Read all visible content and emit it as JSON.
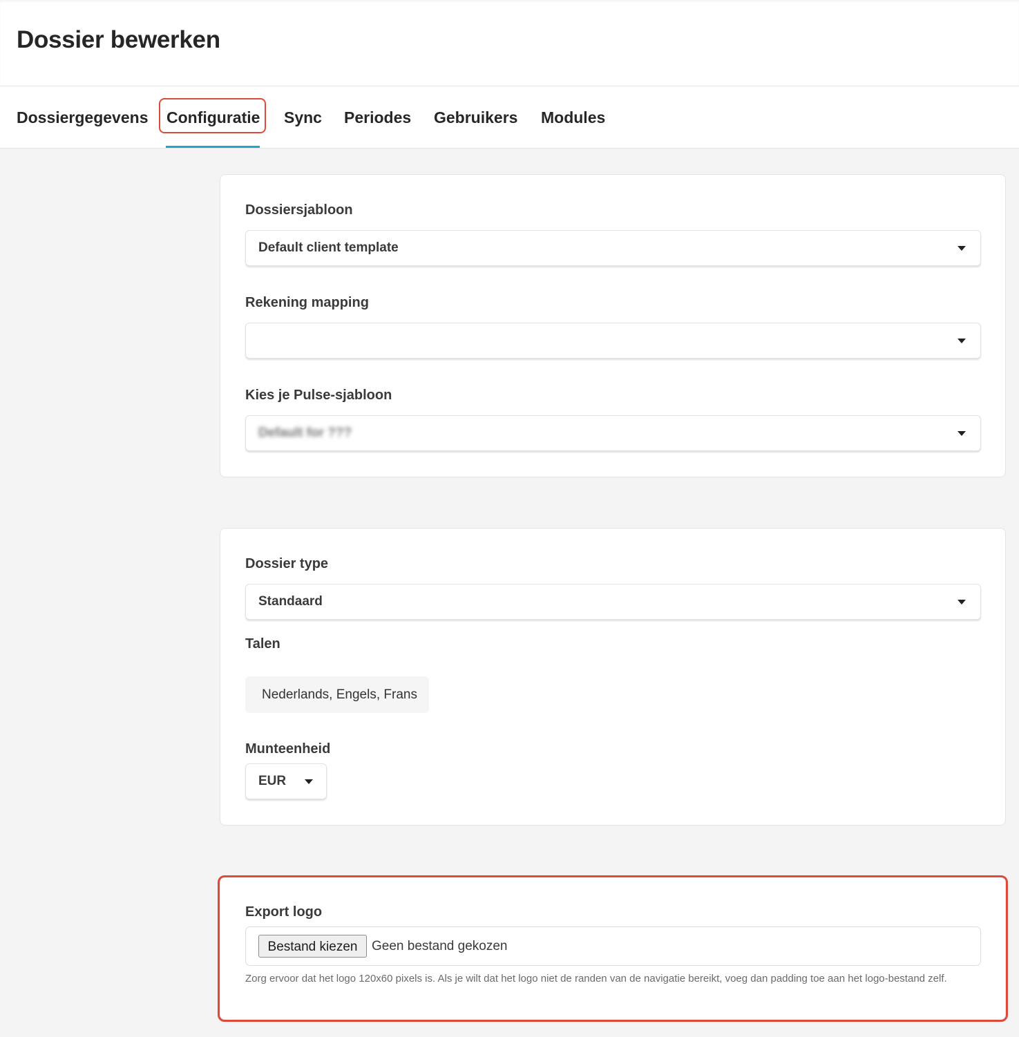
{
  "page": {
    "title": "Dossier bewerken"
  },
  "tabs": [
    {
      "label": "Dossiergegevens"
    },
    {
      "label": "Configuratie",
      "active": true
    },
    {
      "label": "Sync"
    },
    {
      "label": "Periodes"
    },
    {
      "label": "Gebruikers"
    },
    {
      "label": "Modules"
    }
  ],
  "colors": {
    "active_tab_underline": "#1fa6c2",
    "highlight": "#dc4a3a"
  },
  "template_card": {
    "dossier_template": {
      "label": "Dossiersjabloon",
      "value": "Default client template"
    },
    "account_mapping": {
      "label": "Rekening mapping",
      "value": ""
    },
    "pulse_template": {
      "label": "Kies je Pulse-sjabloon",
      "value": "Default for ???"
    }
  },
  "type_card": {
    "dossier_type": {
      "label": "Dossier type",
      "value": "Standaard"
    },
    "languages": {
      "label": "Talen",
      "value": "Nederlands, Engels, Frans"
    },
    "currency": {
      "label": "Munteenheid",
      "value": "EUR"
    }
  },
  "logo_card": {
    "label": "Export logo",
    "file_button": "Bestand kiezen",
    "file_status": "Geen bestand gekozen",
    "help": "Zorg ervoor dat het logo 120x60 pixels is. Als je wilt dat het logo niet de randen van de navigatie bereikt, voeg dan padding toe aan het logo-bestand zelf."
  }
}
